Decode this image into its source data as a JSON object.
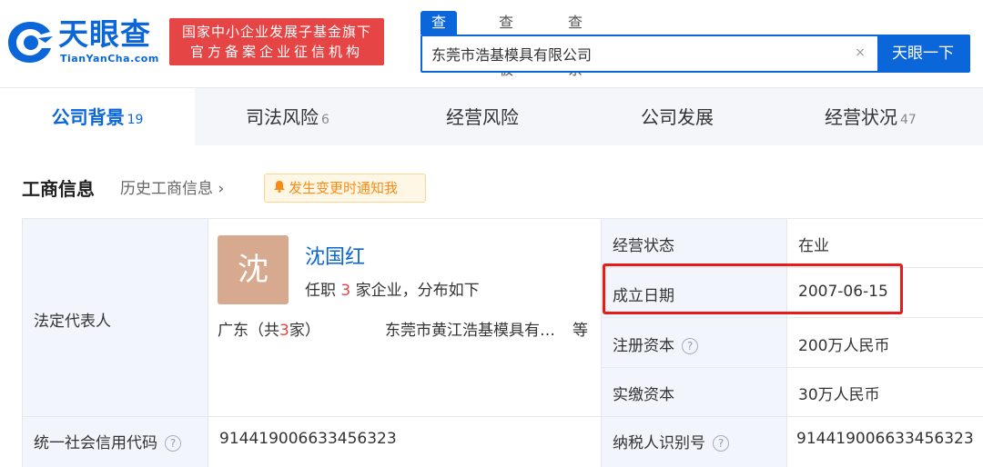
{
  "header": {
    "logo_cn": "天眼查",
    "logo_en": "TianYanCha.com",
    "slogan_line1": "国家中小企业发展子基金旗下",
    "slogan_line2": "官方备案企业征信机构",
    "search_tabs": [
      "查公司",
      "查老板",
      "查关系"
    ],
    "search_value": "东莞市浩基模具有限公司",
    "clear_symbol": "×",
    "search_button": "天眼一下",
    "brand_color": "#0a66d9"
  },
  "nav": {
    "tabs": [
      {
        "label": "公司背景",
        "count": "19"
      },
      {
        "label": "司法风险",
        "count": "6"
      },
      {
        "label": "经营风险",
        "count": ""
      },
      {
        "label": "公司发展",
        "count": ""
      },
      {
        "label": "经营状况",
        "count": "47"
      }
    ]
  },
  "section": {
    "title": "工商信息",
    "history_link": "历史工商信息",
    "history_chevron": "›",
    "notify_button": "发生变更时通知我"
  },
  "info": {
    "legal_rep_label": "法定代表人",
    "rep_avatar_char": "沈",
    "rep_name": "沈国红",
    "rep_desc_pre": "任职",
    "rep_desc_count": "3",
    "rep_desc_post": "家企业，分布如下",
    "rep_region_pre": "广东（共",
    "rep_region_count": "3",
    "rep_region_post": "家）",
    "rep_company": "东莞市黄江浩基模具有限公司",
    "rep_etc": "等",
    "status_label": "经营状态",
    "status_value": "在业",
    "founded_label": "成立日期",
    "founded_value": "2007-06-15",
    "reg_capital_label": "注册资本",
    "reg_capital_value": "200万人民币",
    "paid_capital_label": "实缴资本",
    "paid_capital_value": "30万人民币",
    "credit_code_label": "统一社会信用代码",
    "credit_code_value": "91441900663345632",
    "credit_code_suffix": "3",
    "taxpayer_label": "纳税人识别号",
    "taxpayer_value": "914419006633456323",
    "help_symbol": "?"
  }
}
